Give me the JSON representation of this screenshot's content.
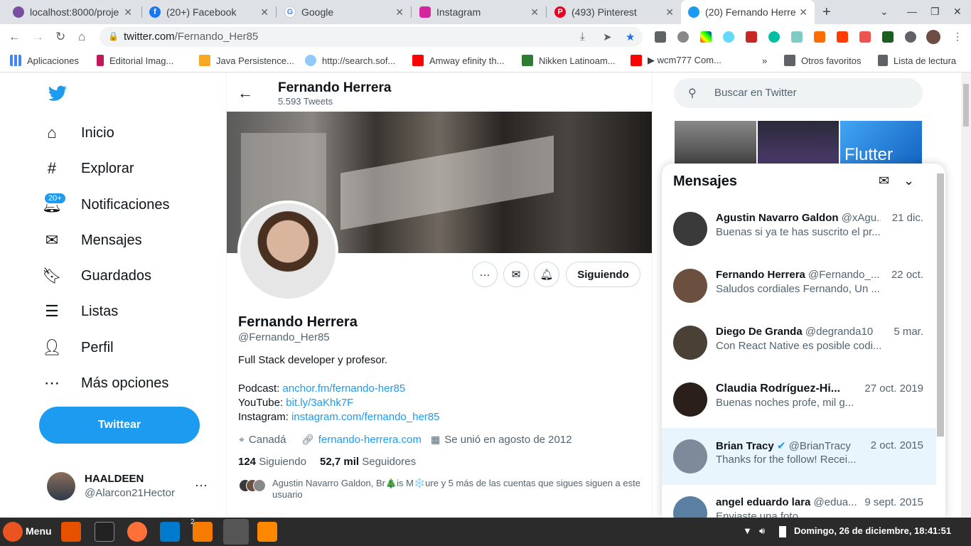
{
  "browser": {
    "tabs": [
      {
        "title": "localhost:8000/proje",
        "icon": "localhost-icon"
      },
      {
        "title": "(20+) Facebook",
        "icon": "facebook-icon"
      },
      {
        "title": "Google",
        "icon": "google-icon"
      },
      {
        "title": "Instagram",
        "icon": "instagram-icon"
      },
      {
        "title": "(493) Pinterest",
        "icon": "pinterest-icon"
      },
      {
        "title": "(20) Fernando Herre",
        "icon": "twitter-icon"
      }
    ],
    "url_host": "twitter.com",
    "url_path": "/Fernando_Her85",
    "bookmarks": [
      "Aplicaciones",
      "Editorial Imag...",
      "Java Persistence...",
      "http://search.sof...",
      "Amway efinity th...",
      "Nikken Latinoam...",
      "▶ wcm777 Com...",
      "»",
      "Otros favoritos",
      "Lista de lectura"
    ]
  },
  "nav": {
    "items": [
      {
        "label": "Inicio",
        "icon": "home-icon"
      },
      {
        "label": "Explorar",
        "icon": "hashtag-icon"
      },
      {
        "label": "Notificaciones",
        "icon": "bell-icon"
      },
      {
        "label": "Mensajes",
        "icon": "mail-icon"
      },
      {
        "label": "Guardados",
        "icon": "bookmark-icon"
      },
      {
        "label": "Listas",
        "icon": "list-icon"
      },
      {
        "label": "Perfil",
        "icon": "user-icon"
      },
      {
        "label": "Más opciones",
        "icon": "more-circle-icon"
      }
    ],
    "notif_badge": "20+",
    "tweet_button": "Twittear",
    "account": {
      "name": "HAALDEEN",
      "handle": "@Alarcon21Hector",
      "more": "···"
    }
  },
  "header": {
    "name": "Fernando Herrera",
    "tweet_count": "5.593 Tweets"
  },
  "profile": {
    "name": "Fernando Herrera",
    "handle": "@Fernando_Her85",
    "bio": "Full Stack developer y profesor.",
    "links": [
      {
        "label": "Podcast: ",
        "link": "anchor.fm/fernando-her85"
      },
      {
        "label": "YouTube: ",
        "link": "bit.ly/3aKhk7F"
      },
      {
        "label": "Instagram: ",
        "link": "instagram.com/fernando_her85"
      }
    ],
    "location": "Canadá",
    "website": "fernando-herrera.com",
    "joined": "Se unió en agosto de 2012",
    "following_count": "124",
    "following_label": "Siguiendo",
    "followers_count": "52,7 mil",
    "followers_label": "Seguidores",
    "follow_button": "Siguiendo",
    "mutual": "Agustin Navarro Galdon, Br🎄is M❄️ure y 5 más de las cuentas que sigues siguen a este usuario"
  },
  "search": {
    "placeholder": "Buscar en Twitter"
  },
  "thumbs": {
    "flutter": "Flutter"
  },
  "messages": {
    "title": "Mensajes",
    "conversations": [
      {
        "name": "Agustin Navarro Galdon",
        "handle": "@xAgu...",
        "date": "21 dic.",
        "preview": "Buenas si ya te has suscrito el pr...",
        "color": "#3a3a3a",
        "verified": false
      },
      {
        "name": "Fernando Herrera",
        "handle": "@Fernando_...",
        "date": "22 oct.",
        "preview": "Saludos cordiales Fernando, Un ...",
        "color": "#6b5040",
        "verified": false
      },
      {
        "name": "Diego De Granda",
        "handle": "@degranda10",
        "date": "5 mar.",
        "preview": "Con React Native es posible codi...",
        "color": "#4a4036",
        "verified": false
      },
      {
        "name": "Claudia Rodríguez-Hi...",
        "handle": "",
        "date": "27 oct. 2019",
        "preview": "Buenas noches profe, mil g...",
        "color": "#2a1f1a",
        "verified": false
      },
      {
        "name": "Brian Tracy",
        "handle": "@BrianTracy",
        "date": "2 oct. 2015",
        "preview": "Thanks for the follow! Recei...",
        "color": "#7d8a99",
        "verified": true
      },
      {
        "name": "angel eduardo lara",
        "handle": "@edua...",
        "date": "9 sept. 2015",
        "preview": "Enviaste una foto",
        "color": "#5b7fa3",
        "verified": false
      }
    ]
  },
  "taskbar": {
    "menu": "Menu",
    "clock": "Domingo, 26 de diciembre, 18:41:51",
    "files_badge": "2"
  }
}
